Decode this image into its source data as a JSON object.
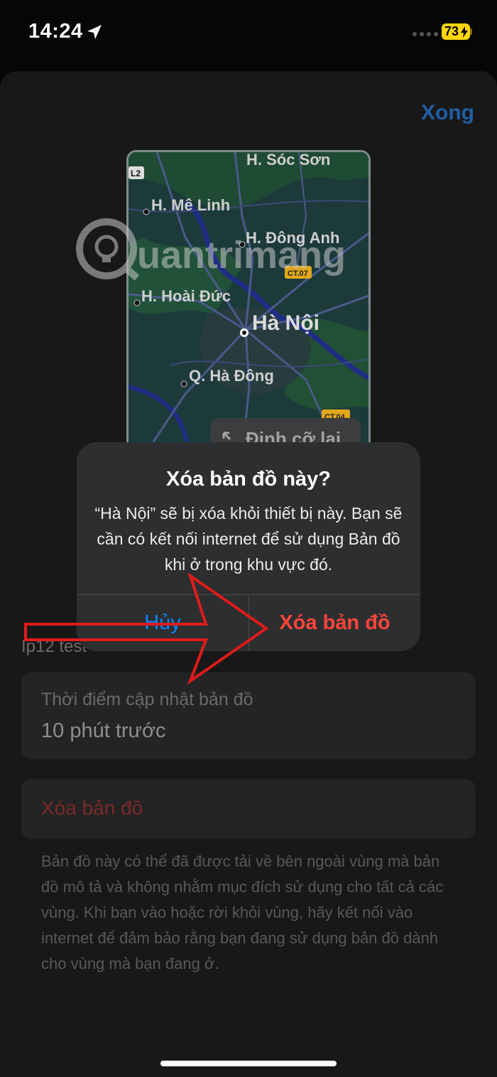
{
  "status": {
    "time": "14:24",
    "battery": "73"
  },
  "nav": {
    "done_label": "Xong"
  },
  "map": {
    "places": {
      "soc_son": "H. Sóc Sơn",
      "me_linh": "H. Mê Linh",
      "dong_anh": "H. Đông Anh",
      "hoai_duc": "H. Hoài Đức",
      "ha_noi": "Hà Nội",
      "ha_dong": "Q. Hà Đông"
    },
    "road_badges": {
      "l2": "L2",
      "ct07": "CT.07",
      "ct04": "CT.04"
    },
    "resize_label": "Định cỡ lại"
  },
  "watermark": "uantrimang",
  "section_label": "Ip12 test",
  "info": {
    "label": "Thời điểm cập nhật bản đồ",
    "value": "10 phút trước"
  },
  "delete_row": "Xóa bản đồ",
  "footnote": "Bản đồ này có thể đã được tải về bên ngoài vùng mà bản đồ mô tả và không nhằm mục đích sử dụng cho tất cả các vùng. Khi bạn vào hoặc rời khỏi vùng, hãy kết nối vào internet để đảm bảo rằng bạn đang sử dụng bản đồ dành cho vùng mà bạn đang ở.",
  "dialog": {
    "title": "Xóa bản đồ này?",
    "message": "“Hà Nội” sẽ bị xóa khỏi thiết bị này. Bạn sẽ cần có kết nối internet để sử dụng Bản đồ khi ở trong khu vực đó.",
    "cancel": "Hủy",
    "confirm": "Xóa bản đồ"
  },
  "colors": {
    "accent_blue": "#0a84ff",
    "destructive_red": "#ff453a",
    "annotation_red": "#e01b1b"
  }
}
